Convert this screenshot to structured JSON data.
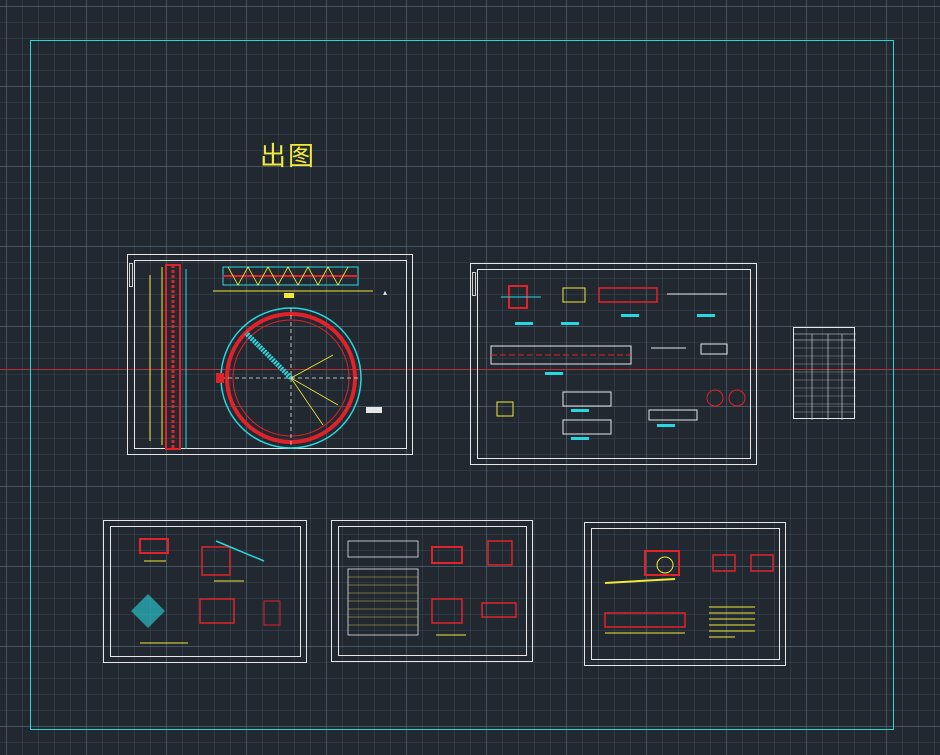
{
  "drawing": {
    "title": "出图"
  },
  "colors": {
    "background": "#212830",
    "limits_frame": "#27d6d8",
    "title_text": "#f1ea3a",
    "sheet_frame": "#e6e6e6",
    "crosshair": "#b2333a",
    "red_member": "#e0222a",
    "cyan_line": "#29d7e0",
    "yellow_text": "#f1ea3a"
  },
  "sheets": [
    {
      "name": "circular-plan-sheet"
    },
    {
      "name": "detail-sheet-upper-right"
    },
    {
      "name": "schedule-table"
    },
    {
      "name": "detail-sheet-lower-left"
    },
    {
      "name": "table-detail-sheet-lower-middle"
    },
    {
      "name": "detail-sheet-lower-right"
    }
  ]
}
